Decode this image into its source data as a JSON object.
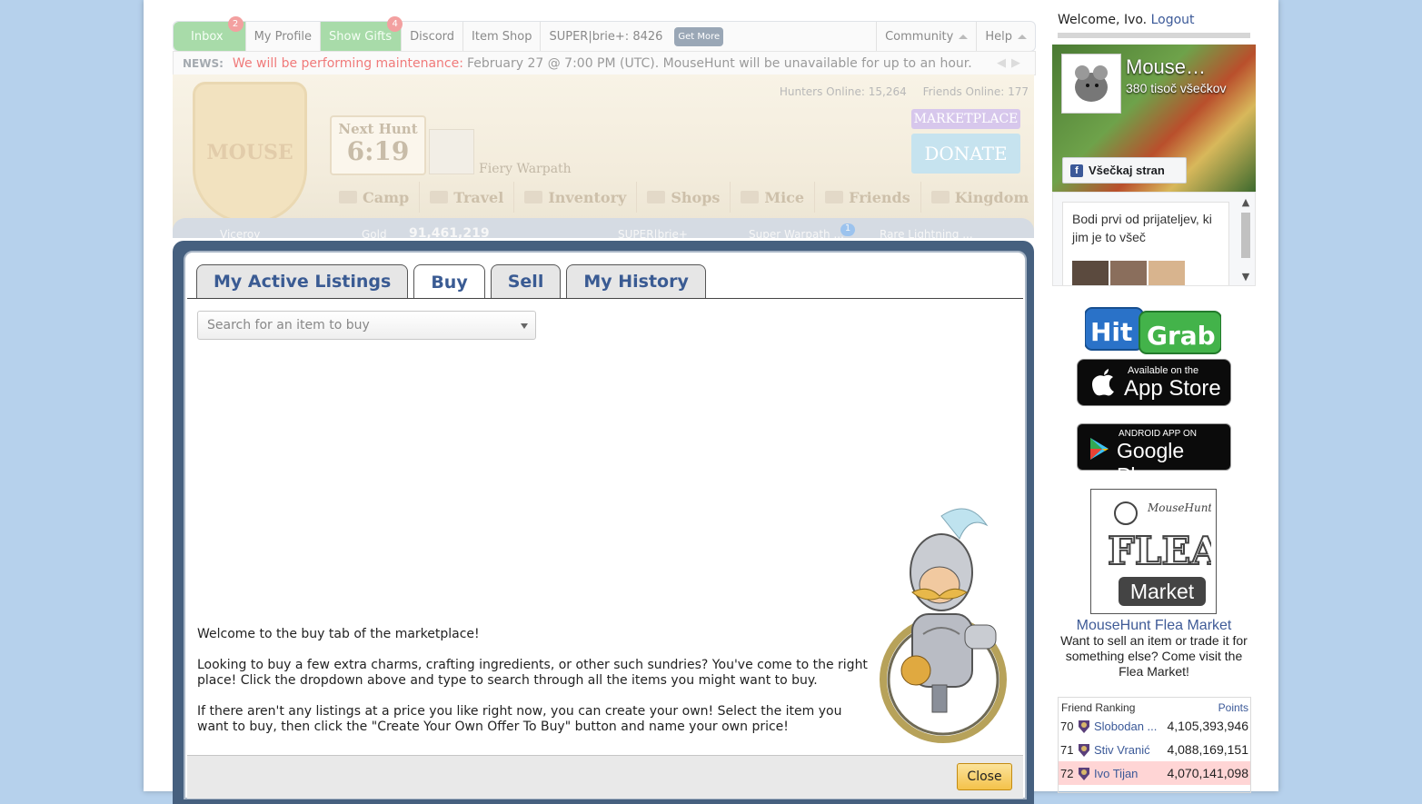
{
  "topnav": {
    "inbox": {
      "label": "Inbox",
      "count": "2"
    },
    "profile": "My Profile",
    "gifts": {
      "label": "Show Gifts",
      "count": "4"
    },
    "discord": "Discord",
    "item_shop": "Item Shop",
    "superbrie": "SUPER|brie+: 8426",
    "get_more": "Get More",
    "community": "Community",
    "help": "Help"
  },
  "news": {
    "label": "NEWS:",
    "alert": "We will be performing maintenance:",
    "text": "February 27 @ 7:00 PM (UTC). MouseHunt will be unavailable for up to an hour."
  },
  "hud": {
    "hunters_online": "Hunters Online: 15,264",
    "friends_online": "Friends Online: 177",
    "crest_text": "MOUSE",
    "next_hunt_label": "Next Hunt",
    "next_hunt_time": "6:19",
    "location": "Fiery Warpath",
    "marketplace_btn": "MARKETPLACE",
    "donate_btn": "DONATE",
    "menu": [
      "Camp",
      "Travel",
      "Inventory",
      "Shops",
      "Mice",
      "Friends",
      "Kingdom"
    ],
    "rank": "Viceroy",
    "gold_label": "Gold",
    "gold_value": "91,461,219",
    "superbrie_item": "SUPER|brie+",
    "weapon": "Super Warpath ...",
    "badge": "1",
    "base": "Rare Lightning ..."
  },
  "market": {
    "tabs": [
      "My Active Listings",
      "Buy",
      "Sell",
      "My History"
    ],
    "active_tab": "Buy",
    "search_placeholder": "Search for an item to buy",
    "welcome": [
      "Welcome to the buy tab of the marketplace!",
      "Looking to buy a few extra charms, crafting ingredients, or other such sundries? You've come to the right place! Click the dropdown above and type to search through all the items you might want to buy.",
      "If there aren't any listings at a price you like right now, you can create your own! Select the item you want to buy, then click the \"Create Your Own Offer To Buy\" button and name your own price!"
    ],
    "close": "Close"
  },
  "sidebar": {
    "welcome": "Welcome, Ivo.",
    "logout": "Logout",
    "fb_page_name": "Mouse…",
    "fb_likes": "380 tisoč všečkov",
    "fb_like_btn": "Všečkaj stran",
    "fb_friends_text": "Bodi prvi od prijateljev, ki jim je to všeč",
    "hitgrab": "HitGrab",
    "appstore_small": "Available on the",
    "appstore_big": "App Store",
    "gplay_small": "ANDROID APP ON",
    "gplay_big": "Google Play",
    "flea_logo_text": "MouseHunt",
    "flea_logo_word": "FLEA",
    "flea_logo_market": "Market",
    "flea_title": "MouseHunt Flea Market",
    "flea_desc": "Want to sell an item or trade it for something else? Come visit the Flea Market!",
    "ranking_title": "Friend Ranking",
    "ranking_points": "Points",
    "ranking": [
      {
        "rank": "70",
        "name": "Slobodan ...",
        "points": "4,105,393,946"
      },
      {
        "rank": "71",
        "name": "Stiv Vranić",
        "points": "4,088,169,151"
      },
      {
        "rank": "72",
        "name": "Ivo Tijan",
        "points": "4,070,141,098"
      }
    ]
  },
  "colors": {
    "accent": "#3a5b93",
    "popup_frame": "#46607f",
    "close_btn": "#f4c24a"
  }
}
